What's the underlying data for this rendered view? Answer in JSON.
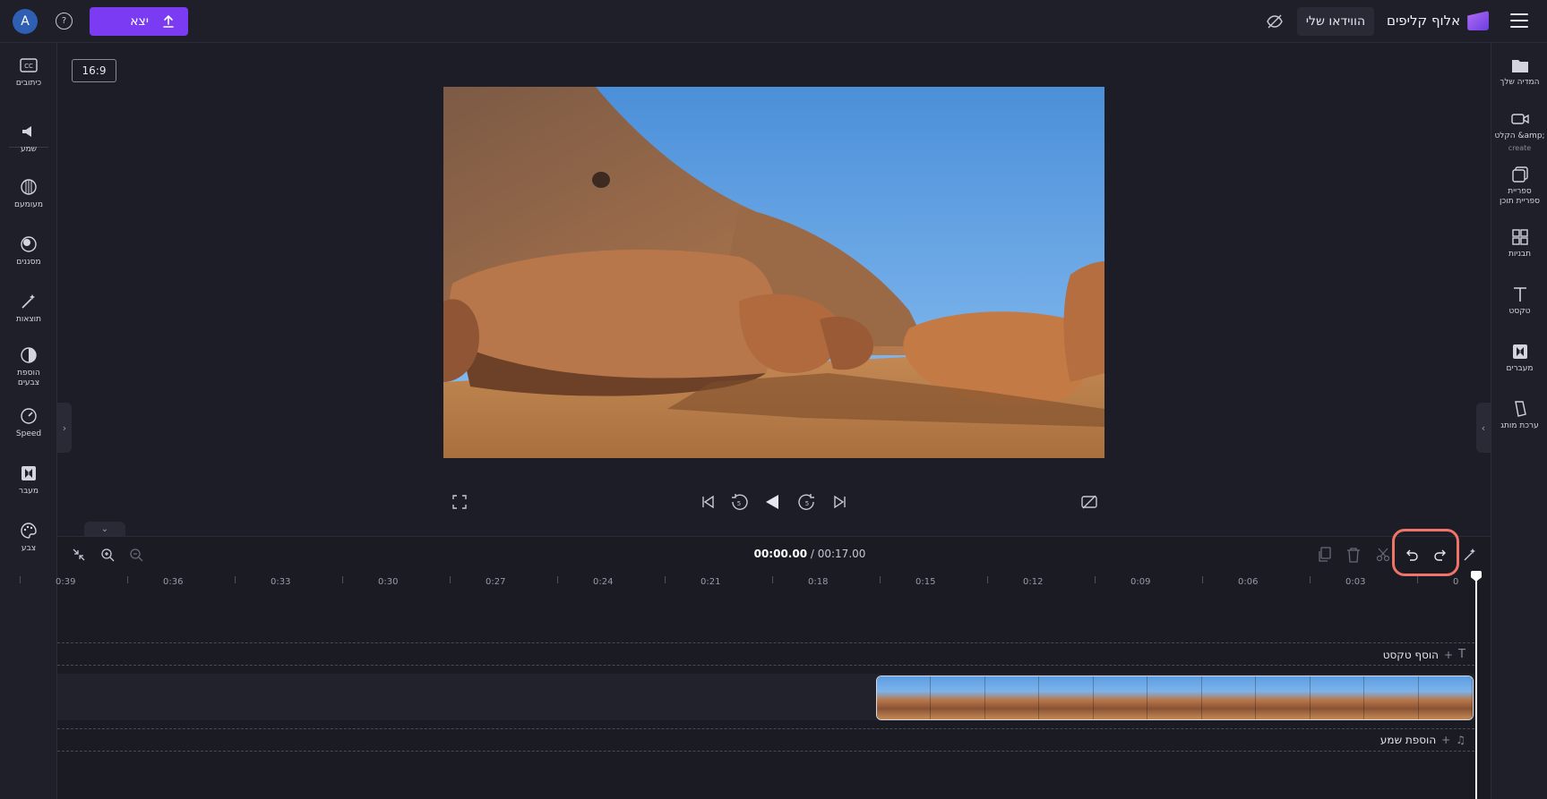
{
  "topbar": {
    "avatar_letter": "A",
    "help_icon": "question-icon",
    "export_label": "יצא",
    "my_videos_label": "הווידאו שלי",
    "brand_name": "אלוף קליפים"
  },
  "left_tools": [
    {
      "name": "captions",
      "label": "כיתובים",
      "icon": "cc-icon"
    },
    {
      "name": "audio",
      "label": "שמע",
      "icon": "speaker-icon"
    },
    {
      "name": "fade",
      "label": "מעומעם",
      "icon": "fade-icon"
    },
    {
      "name": "filters",
      "label": "מסננים",
      "icon": "filters-icon"
    },
    {
      "name": "effects",
      "label": "תוצאות",
      "icon": "magic-wand-icon"
    },
    {
      "name": "color-adjust",
      "label": "הוספת צבעים",
      "icon": "contrast-icon"
    },
    {
      "name": "speed",
      "label": "Speed",
      "icon": "speedometer-icon"
    },
    {
      "name": "transition",
      "label": "מעבר",
      "icon": "transition-icon"
    },
    {
      "name": "color",
      "label": "צבע",
      "icon": "palette-icon"
    }
  ],
  "right_tools": [
    {
      "name": "your-media",
      "label": "המדיה שלך",
      "icon": "folder-icon"
    },
    {
      "name": "record-create",
      "label": "הקלט &amp;",
      "sub": "create",
      "icon": "camera-icon"
    },
    {
      "name": "content-library",
      "label": "ספריית ספריית תוכן",
      "icon": "library-icon"
    },
    {
      "name": "templates",
      "label": "תבניות",
      "icon": "templates-icon"
    },
    {
      "name": "text",
      "label": "טקסט",
      "icon": "text-icon"
    },
    {
      "name": "transitions",
      "label": "מעברים",
      "icon": "transition-icon"
    },
    {
      "name": "brand-kit",
      "label": "ערכת מותג",
      "icon": "brand-icon"
    }
  ],
  "stage": {
    "aspect_ratio": "16:9"
  },
  "timeline": {
    "current_time": "00:00.00",
    "separator": " / ",
    "total_time": "00:17.00",
    "ruler": [
      "0",
      "0:03",
      "0:06",
      "0:09",
      "0:12",
      "0:15",
      "0:18",
      "0:21",
      "0:24",
      "0:27",
      "0:30",
      "0:33",
      "0:36",
      "0:39"
    ],
    "add_text_label": "הוסף טקסט",
    "add_audio_label": "הוספת שמע"
  },
  "colors": {
    "accent": "#7a3bf2",
    "highlight": "#f07468",
    "background": "#1d1d27"
  }
}
